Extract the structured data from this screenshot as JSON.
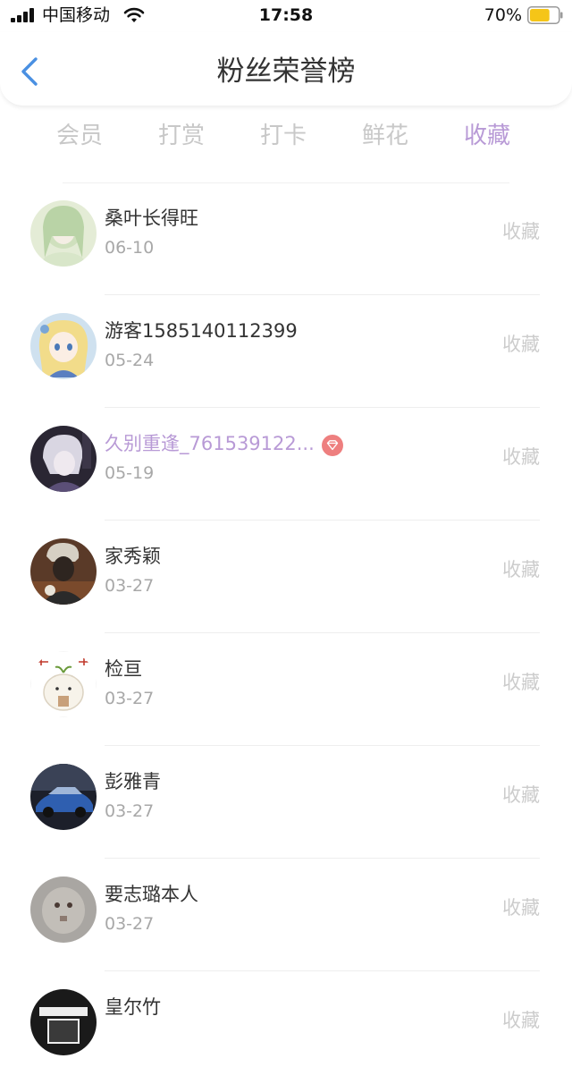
{
  "status_bar": {
    "carrier": "中国移动",
    "time": "17:58",
    "battery": "70%",
    "battery_level": 0.7,
    "battery_color": "#f5c518"
  },
  "header": {
    "title": "粉丝荣誉榜",
    "back_icon": "chevron-left-icon",
    "accent": "#4a90e2"
  },
  "tabs": [
    {
      "label": "会员",
      "active": false
    },
    {
      "label": "打赏",
      "active": false
    },
    {
      "label": "打卡",
      "active": false
    },
    {
      "label": "鲜花",
      "active": false
    },
    {
      "label": "收藏",
      "active": true
    }
  ],
  "colors": {
    "active_tab": "#b89ad6",
    "inactive_tab": "#c8c8c8",
    "vip_name": "#b89ad6",
    "vip_badge": "#ee7f7f"
  },
  "fans": [
    {
      "name": "桑叶长得旺",
      "date": "06-10",
      "action": "收藏",
      "vip": false
    },
    {
      "name": "游客1585140112399",
      "date": "05-24",
      "action": "收藏",
      "vip": false
    },
    {
      "name": "久别重逢_761539122...",
      "date": "05-19",
      "action": "收藏",
      "vip": true
    },
    {
      "name": "家秀颖",
      "date": "03-27",
      "action": "收藏",
      "vip": false
    },
    {
      "name": "检亘",
      "date": "03-27",
      "action": "收藏",
      "vip": false
    },
    {
      "name": "彭雅青",
      "date": "03-27",
      "action": "收藏",
      "vip": false
    },
    {
      "name": "要志璐本人",
      "date": "03-27",
      "action": "收藏",
      "vip": false
    },
    {
      "name": "皇尔竹",
      "date": "",
      "action": "收藏",
      "vip": false
    }
  ]
}
